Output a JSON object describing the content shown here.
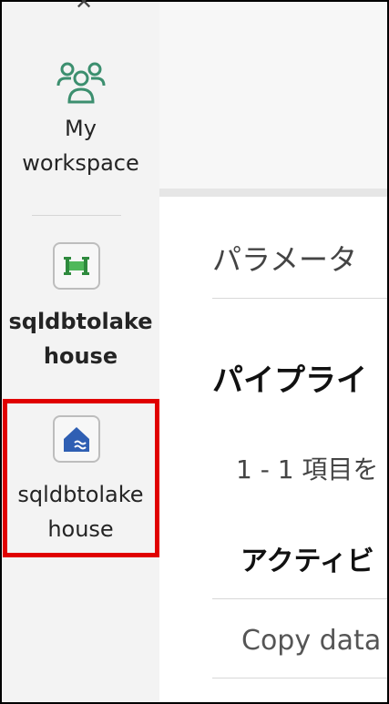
{
  "sidebar": {
    "close_icon": "close-icon",
    "items": [
      {
        "label_line1": "My",
        "label_line2": "workspace",
        "icon": "people-icon"
      },
      {
        "label_line1": "sqldbtolake",
        "label_line2": "house",
        "icon": "pipeline-icon"
      },
      {
        "label_line1": "sqldbtolake",
        "label_line2": "house",
        "icon": "lakehouse-icon"
      }
    ]
  },
  "main": {
    "tab_parameters": "パラメータ",
    "section_pipeline": "パイプライ",
    "count_text": "1 - 1 項目を",
    "section_activity": "アクティビ",
    "row_copy": "Copy data"
  },
  "colors": {
    "highlight": "#e00000",
    "pipeline_green": "#2e8a3d",
    "lakehouse_blue": "#2f5fb3",
    "workspace_teal": "#3c8f6f"
  }
}
